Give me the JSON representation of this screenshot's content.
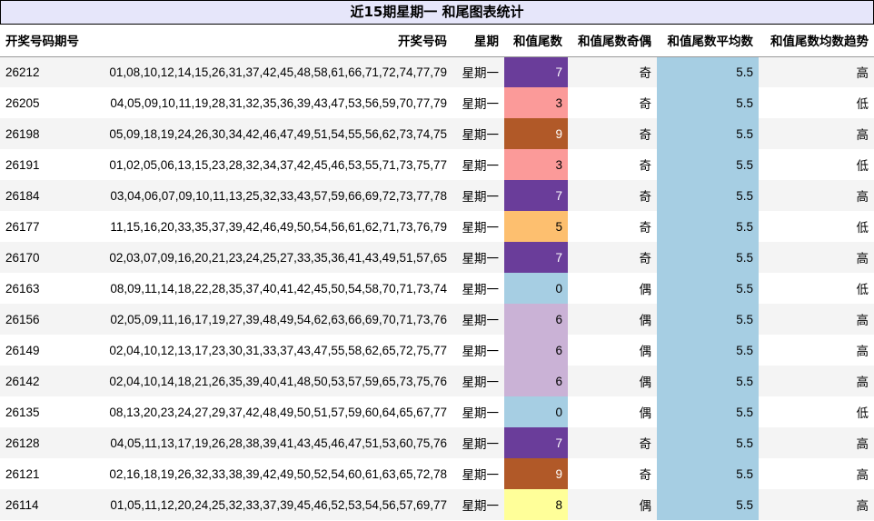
{
  "title": "近15期星期一 和尾图表统计",
  "columns": [
    {
      "key": "period",
      "label": "开奖号码期号",
      "align": "left",
      "width": 100
    },
    {
      "key": "numbers",
      "label": "开奖号码",
      "align": "right",
      "width": 398
    },
    {
      "key": "weekday",
      "label": "星期",
      "align": "right",
      "width": 57
    },
    {
      "key": "tail",
      "label": "和值尾数",
      "align": "right",
      "width": 70
    },
    {
      "key": "parity",
      "label": "和值尾数奇偶",
      "align": "right",
      "width": 98
    },
    {
      "key": "avg",
      "label": "和值尾数平均数",
      "align": "right",
      "width": 112
    },
    {
      "key": "trend",
      "label": "和值尾数均数趋势",
      "align": "right",
      "width": 127
    }
  ],
  "colors": {
    "avg_fill": "#a6cee3",
    "tail_colors": {
      "0": "#a6cee3",
      "3": "#fb9a99",
      "5": "#fdbf6f",
      "6": "#cab2d6",
      "7": "#6a3d9a",
      "8": "#ffff99",
      "9": "#b15928"
    },
    "tail_text_colors": {
      "7": "#ffffff",
      "9": "#ffffff"
    }
  },
  "rows": [
    {
      "period": "26212",
      "numbers": "01,08,10,12,14,15,26,31,37,42,45,48,58,61,66,71,72,74,77,79",
      "weekday": "星期一",
      "tail": "7",
      "parity": "奇",
      "avg": "5.5",
      "trend": "高"
    },
    {
      "period": "26205",
      "numbers": "04,05,09,10,11,19,28,31,32,35,36,39,43,47,53,56,59,70,77,79",
      "weekday": "星期一",
      "tail": "3",
      "parity": "奇",
      "avg": "5.5",
      "trend": "低"
    },
    {
      "period": "26198",
      "numbers": "05,09,18,19,24,26,30,34,42,46,47,49,51,54,55,56,62,73,74,75",
      "weekday": "星期一",
      "tail": "9",
      "parity": "奇",
      "avg": "5.5",
      "trend": "高"
    },
    {
      "period": "26191",
      "numbers": "01,02,05,06,13,15,23,28,32,34,37,42,45,46,53,55,71,73,75,77",
      "weekday": "星期一",
      "tail": "3",
      "parity": "奇",
      "avg": "5.5",
      "trend": "低"
    },
    {
      "period": "26184",
      "numbers": "03,04,06,07,09,10,11,13,25,32,33,43,57,59,66,69,72,73,77,78",
      "weekday": "星期一",
      "tail": "7",
      "parity": "奇",
      "avg": "5.5",
      "trend": "高"
    },
    {
      "period": "26177",
      "numbers": "11,15,16,20,33,35,37,39,42,46,49,50,54,56,61,62,71,73,76,79",
      "weekday": "星期一",
      "tail": "5",
      "parity": "奇",
      "avg": "5.5",
      "trend": "低"
    },
    {
      "period": "26170",
      "numbers": "02,03,07,09,16,20,21,23,24,25,27,33,35,36,41,43,49,51,57,65",
      "weekday": "星期一",
      "tail": "7",
      "parity": "奇",
      "avg": "5.5",
      "trend": "高"
    },
    {
      "period": "26163",
      "numbers": "08,09,11,14,18,22,28,35,37,40,41,42,45,50,54,58,70,71,73,74",
      "weekday": "星期一",
      "tail": "0",
      "parity": "偶",
      "avg": "5.5",
      "trend": "低"
    },
    {
      "period": "26156",
      "numbers": "02,05,09,11,16,17,19,27,39,48,49,54,62,63,66,69,70,71,73,76",
      "weekday": "星期一",
      "tail": "6",
      "parity": "偶",
      "avg": "5.5",
      "trend": "高"
    },
    {
      "period": "26149",
      "numbers": "02,04,10,12,13,17,23,30,31,33,37,43,47,55,58,62,65,72,75,77",
      "weekday": "星期一",
      "tail": "6",
      "parity": "偶",
      "avg": "5.5",
      "trend": "高"
    },
    {
      "period": "26142",
      "numbers": "02,04,10,14,18,21,26,35,39,40,41,48,50,53,57,59,65,73,75,76",
      "weekday": "星期一",
      "tail": "6",
      "parity": "偶",
      "avg": "5.5",
      "trend": "高"
    },
    {
      "period": "26135",
      "numbers": "08,13,20,23,24,27,29,37,42,48,49,50,51,57,59,60,64,65,67,77",
      "weekday": "星期一",
      "tail": "0",
      "parity": "偶",
      "avg": "5.5",
      "trend": "低"
    },
    {
      "period": "26128",
      "numbers": "04,05,11,13,17,19,26,28,38,39,41,43,45,46,47,51,53,60,75,76",
      "weekday": "星期一",
      "tail": "7",
      "parity": "奇",
      "avg": "5.5",
      "trend": "高"
    },
    {
      "period": "26121",
      "numbers": "02,16,18,19,26,32,33,38,39,42,49,50,52,54,60,61,63,65,72,78",
      "weekday": "星期一",
      "tail": "9",
      "parity": "奇",
      "avg": "5.5",
      "trend": "高"
    },
    {
      "period": "26114",
      "numbers": "01,05,11,12,20,24,25,32,33,37,39,45,46,52,53,54,56,57,69,77",
      "weekday": "星期一",
      "tail": "8",
      "parity": "偶",
      "avg": "5.5",
      "trend": "高"
    }
  ]
}
